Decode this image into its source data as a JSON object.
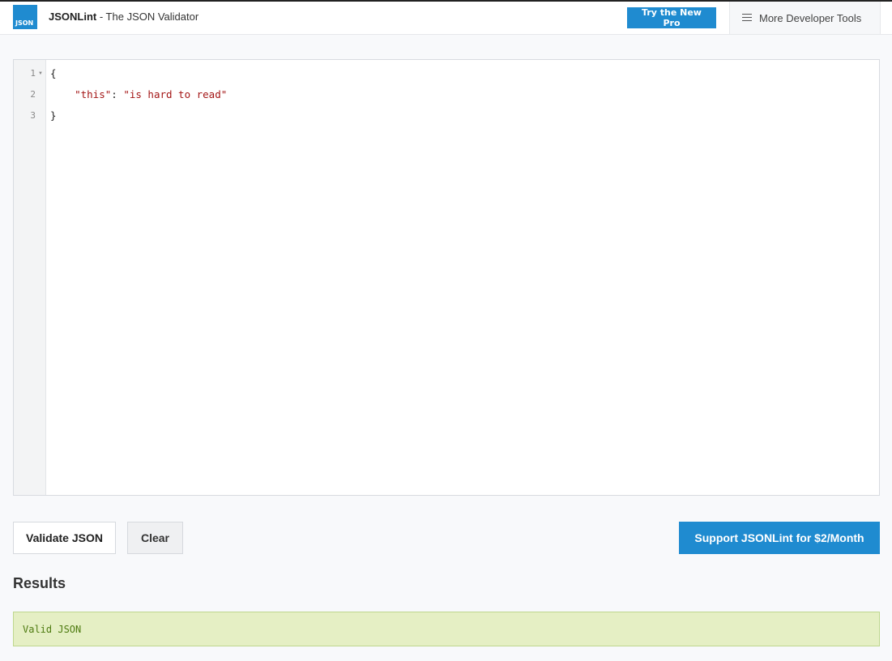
{
  "header": {
    "logo_text": "JSON",
    "brand_name": "JSONLint",
    "brand_suffix": " - The JSON Validator",
    "pro_button": "Try the New Pro",
    "tools_label": "More Developer Tools"
  },
  "editor": {
    "line_numbers": [
      "1",
      "2",
      "3"
    ],
    "lines": [
      {
        "open": "{"
      },
      {
        "indent": "    ",
        "key": "\"this\"",
        "sep": ": ",
        "value": "\"is hard to read\""
      },
      {
        "close": "}"
      }
    ]
  },
  "actions": {
    "validate_label": "Validate JSON",
    "clear_label": "Clear",
    "support_label": "Support JSONLint for $2/Month"
  },
  "results": {
    "title": "Results",
    "message": "Valid JSON"
  },
  "colors": {
    "accent": "#1f8bd0",
    "string_color": "#a31515",
    "success_bg": "#e5efc4",
    "success_text": "#4d7a0f"
  }
}
